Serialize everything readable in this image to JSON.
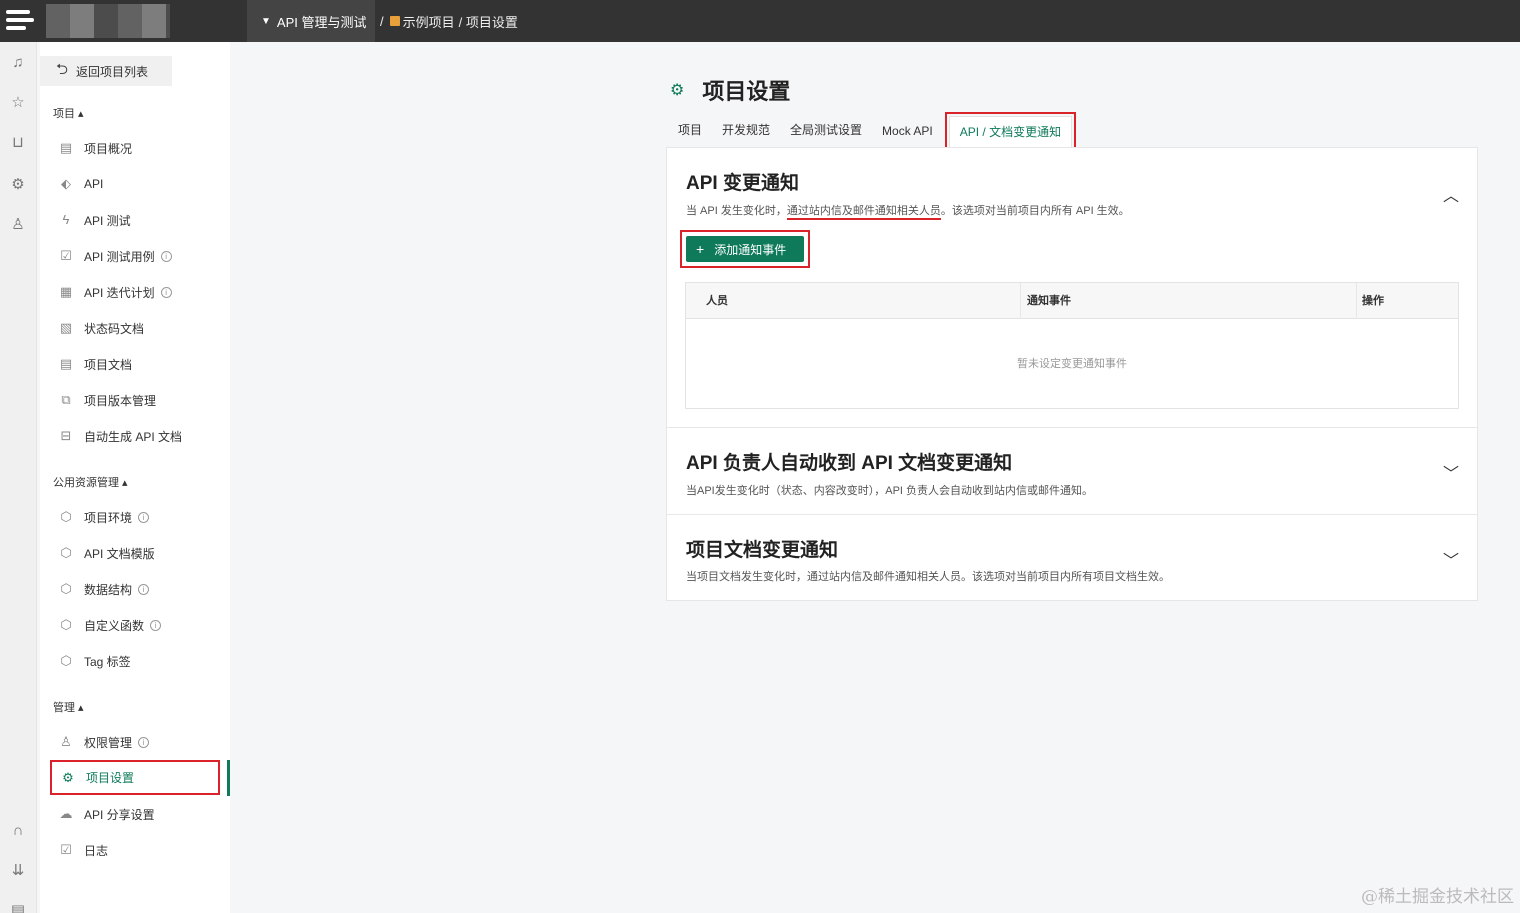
{
  "topbar": {
    "module": "API 管理与测试",
    "crumb_sep": "/",
    "crumb_project": "示例项目",
    "crumb_page": "/ 项目设置"
  },
  "sidebar": {
    "back": "返回项目列表",
    "sections": {
      "project": "项目",
      "public": "公用资源管理",
      "manage": "管理"
    },
    "project_items": [
      "项目概况",
      "API",
      "API 测试",
      "API 测试用例",
      "API 迭代计划",
      "状态码文档",
      "项目文档",
      "项目版本管理",
      "自动生成 API 文档"
    ],
    "public_items": [
      "项目环境",
      "API 文档模版",
      "数据结构",
      "自定义函数",
      "Tag 标签"
    ],
    "manage_items": [
      "权限管理",
      "项目设置",
      "API 分享设置",
      "日志"
    ]
  },
  "main": {
    "title": "项目设置",
    "tabs": [
      "项目",
      "开发规范",
      "全局测试设置",
      "Mock API",
      "API / 文档变更通知"
    ],
    "active_tab": "API / 文档变更通知",
    "panels": [
      {
        "title": "API 变更通知",
        "desc_before": "当 API 发生变化时，",
        "desc_highlight": "通过站内信及邮件通知相关人员",
        "desc_after": "。该选项对当前项目内所有 API 生效。",
        "add_button": "添加通知事件",
        "table_headers": [
          "人员",
          "通知事件",
          "操作"
        ],
        "empty_text": "暂未设定变更通知事件",
        "expanded": true
      },
      {
        "title": "API 负责人自动收到 API 文档变更通知",
        "desc": "当API发生变化时（状态、内容改变时），API 负责人会自动收到站内信或邮件通知。",
        "expanded": false
      },
      {
        "title": "项目文档变更通知",
        "desc": "当项目文档发生变化时，通过站内信及邮件通知相关人员。该选项对当前项目内所有项目文档生效。",
        "expanded": false
      }
    ]
  },
  "watermark": "@稀土掘金技术社区",
  "colors": {
    "accent": "#0e7a5a",
    "highlight": "#d9222a",
    "topbar": "#333333"
  }
}
